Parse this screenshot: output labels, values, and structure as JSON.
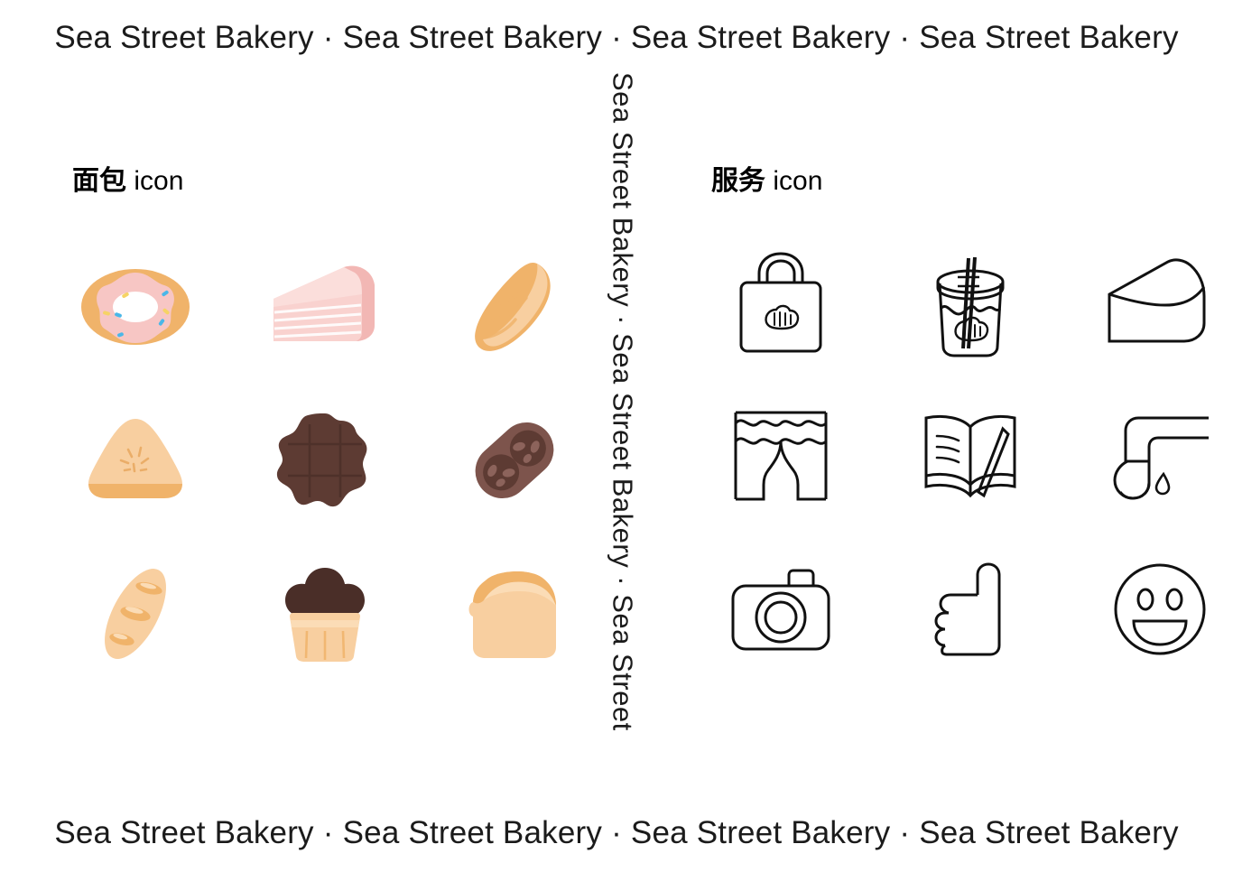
{
  "brand": {
    "name": "Sea Street Bakery",
    "separator": "·"
  },
  "marquee": {
    "top_items": [
      "Sea Street Bakery",
      "Sea Street Bakery",
      "Sea Street Bakery",
      "Sea Street Bakery"
    ],
    "bottom_items": [
      "Sea Street Bakery",
      "Sea Street Bakery",
      "Sea Street Bakery",
      "Sea Street Bakery"
    ],
    "vertical_text": "Sea Street Bakery · Sea Street Bakery · Sea Street"
  },
  "sections": {
    "bread": {
      "title_cjk": "面包",
      "title_latin": "icon",
      "icons": [
        {
          "name": "donut-icon",
          "label": "Donut"
        },
        {
          "name": "cake-slice-icon",
          "label": "Layer cake slice"
        },
        {
          "name": "croissant-icon",
          "label": "Croissant"
        },
        {
          "name": "scone-icon",
          "label": "Scone"
        },
        {
          "name": "chocolate-cookie-icon",
          "label": "Chocolate cookie"
        },
        {
          "name": "chocolate-roll-icon",
          "label": "Chocolate nut roll"
        },
        {
          "name": "baguette-icon",
          "label": "Baguette"
        },
        {
          "name": "cupcake-icon",
          "label": "Chocolate cupcake"
        },
        {
          "name": "toast-icon",
          "label": "Toast slice"
        }
      ]
    },
    "service": {
      "title_cjk": "服务",
      "title_latin": "icon",
      "icons": [
        {
          "name": "shopping-bag-icon",
          "label": "Shopping bag"
        },
        {
          "name": "drink-cup-icon",
          "label": "Drink cup with straw"
        },
        {
          "name": "cake-slice-outline-icon",
          "label": "Cake slice"
        },
        {
          "name": "curtain-icon",
          "label": "Curtains"
        },
        {
          "name": "open-book-pencil-icon",
          "label": "Open book with pencil"
        },
        {
          "name": "faucet-icon",
          "label": "Faucet with water drop"
        },
        {
          "name": "camera-icon",
          "label": "Camera"
        },
        {
          "name": "thumbs-up-icon",
          "label": "Thumbs up"
        },
        {
          "name": "smiley-face-icon",
          "label": "Smiley face"
        }
      ]
    }
  },
  "colors": {
    "background": "#ffffff",
    "text": "#1b1b1b",
    "dough_mid": "#f0b36a",
    "dough_light": "#f8cfa0",
    "dough_pale": "#fbdcb6",
    "icing_pink": "#f7c6c4",
    "cake_pink": "#f9d2cf",
    "cake_pink_dark": "#f2b7b4",
    "chocolate": "#5d3b33",
    "chocolate_dark": "#4a2e28",
    "cocoa": "#7d544c",
    "sprinkle_blue": "#4ab7e8",
    "sprinkle_yellow": "#f6d365",
    "outline": "#111111"
  }
}
